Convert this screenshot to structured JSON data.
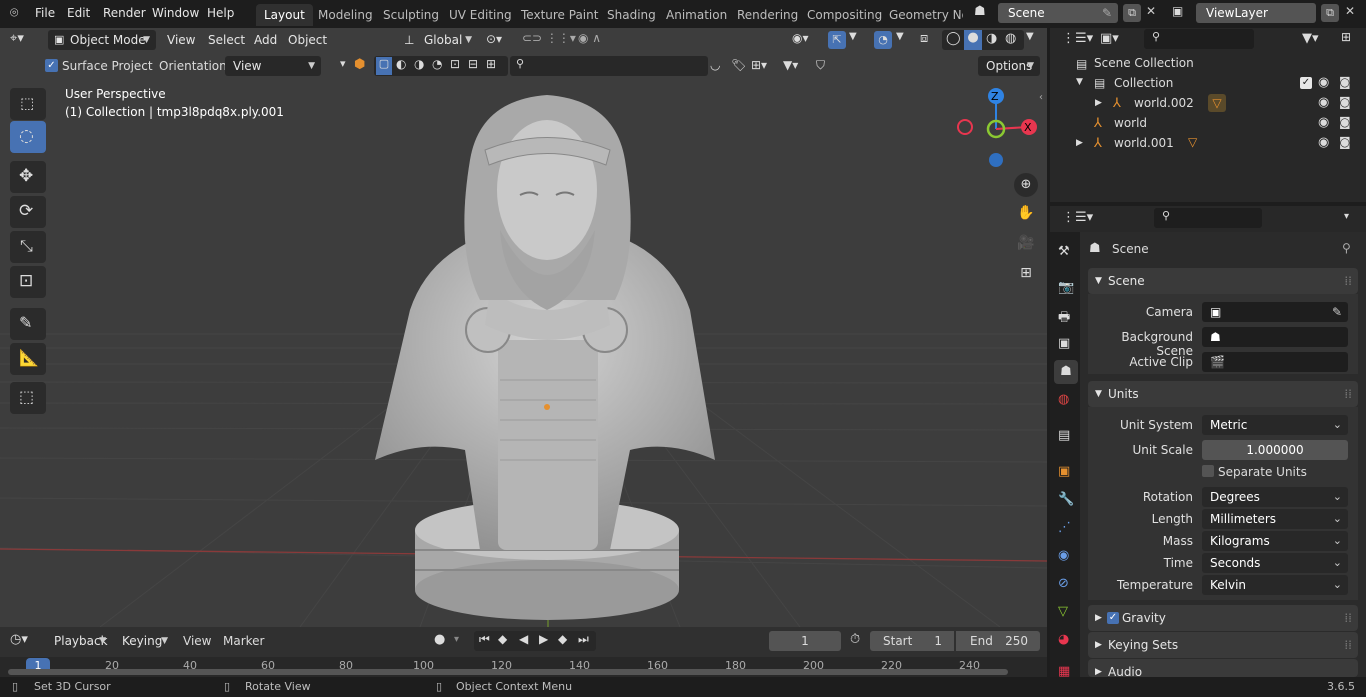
{
  "menu": {
    "file": "File",
    "edit": "Edit",
    "render": "Render",
    "window": "Window",
    "help": "Help"
  },
  "workspaces": [
    "Layout",
    "Modeling",
    "Sculpting",
    "UV Editing",
    "Texture Paint",
    "Shading",
    "Animation",
    "Rendering",
    "Compositing",
    "Geometry Noc"
  ],
  "scene_field": "Scene",
  "view_layer_field": "ViewLayer",
  "viewport": {
    "mode": "Object Mode",
    "menus": {
      "view": "View",
      "select": "Select",
      "add": "Add",
      "object": "Object"
    },
    "transform_orientation": "Global",
    "surface_project": "Surface Project",
    "orientation_label": "Orientation:",
    "orientation_value": "View",
    "options": "Options",
    "overlay_title": "User Perspective",
    "overlay_subtitle": "(1) Collection | tmp3l8pdq8x.ply.001",
    "gizmo": {
      "z": "Z",
      "x": "X"
    }
  },
  "timeline": {
    "playback": "Playback",
    "keying": "Keying",
    "view": "View",
    "marker": "Marker",
    "current_frame": "1",
    "start_label": "Start",
    "start": "1",
    "end_label": "End",
    "end": "250",
    "ruler": [
      "1",
      "20",
      "40",
      "60",
      "80",
      "100",
      "120",
      "140",
      "160",
      "180",
      "200",
      "220",
      "240"
    ]
  },
  "status": {
    "left": "Set 3D Cursor",
    "mid": "Rotate View",
    "right": "Object Context Menu",
    "version": "3.6.5"
  },
  "outliner": {
    "scene_collection": "Scene Collection",
    "items": [
      {
        "label": "Collection"
      },
      {
        "label": "world.002"
      },
      {
        "label": "world"
      },
      {
        "label": "world.001"
      }
    ]
  },
  "properties": {
    "header": "Scene",
    "scene_panel": "Scene",
    "camera_label": "Camera",
    "bg_scene_label": "Background Scene",
    "active_clip_label": "Active Clip",
    "units_panel": "Units",
    "unit_system_label": "Unit System",
    "unit_system": "Metric",
    "unit_scale_label": "Unit Scale",
    "unit_scale": "1.000000",
    "separate_units": "Separate Units",
    "rotation_label": "Rotation",
    "rotation": "Degrees",
    "length_label": "Length",
    "length": "Millimeters",
    "mass_label": "Mass",
    "mass": "Kilograms",
    "time_label": "Time",
    "time": "Seconds",
    "temperature_label": "Temperature",
    "temperature": "Kelvin",
    "gravity": "Gravity",
    "keying_sets": "Keying Sets",
    "audio": "Audio"
  },
  "colors": {
    "accent": "#4772b3",
    "x_axis": "#e8364f",
    "y_axis": "#8bc932",
    "z_axis": "#2f83e3",
    "object_orange": "#e5902f"
  }
}
